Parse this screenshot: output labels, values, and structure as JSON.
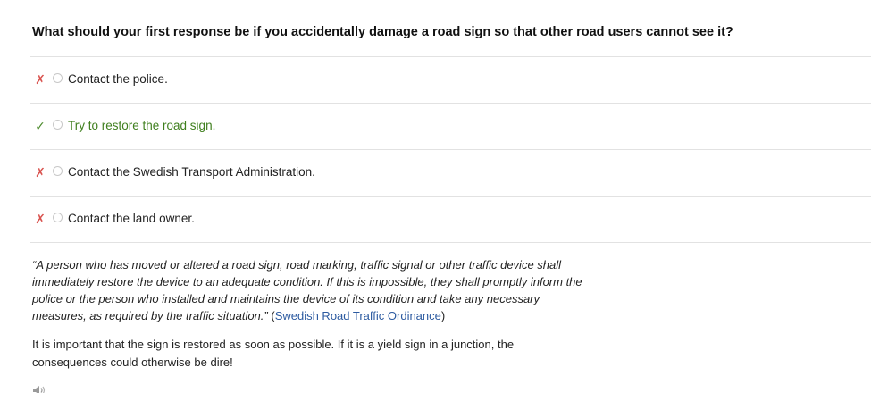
{
  "question": "What should your first response be if you accidentally damage a road sign so that other road users cannot see it?",
  "options": [
    {
      "label": "Contact the police.",
      "mark": "✗",
      "correct": false
    },
    {
      "label": "Try to restore the road sign.",
      "mark": "✓",
      "correct": true
    },
    {
      "label": "Contact the Swedish Transport Administration.",
      "mark": "✗",
      "correct": false
    },
    {
      "label": "Contact the land owner.",
      "mark": "✗",
      "correct": false
    }
  ],
  "explanation": {
    "quote": "“A person who has moved or altered a road sign, road marking, traffic signal or other traffic device shall immediately restore the device to an adequate condition. If this is impossible, they shall promptly inform the police or the person who installed and maintains the device of its condition and take any necessary measures, as required by the traffic situation.”",
    "open_paren": " (",
    "source": "Swedish Road Traffic Ordinance",
    "close_paren": ")"
  },
  "note": "It is important that the sign is restored as soon as possible. If it is a yield sign in a junction, the consequences could otherwise be dire!",
  "colors": {
    "wrong": "#d9534f",
    "correct": "#3f7f1e",
    "link": "#2c5aa0",
    "divider": "#e2e2e2"
  },
  "icons": {
    "audio": "speaker-icon"
  }
}
